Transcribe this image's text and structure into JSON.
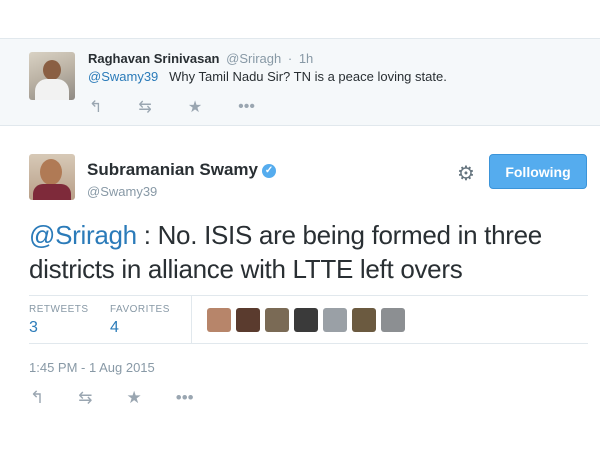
{
  "reply_tweet": {
    "author_name": "Raghavan Srinivasan",
    "author_handle": "@Sriragh",
    "separator": "·",
    "time_ago": "1h",
    "mention": "@Swamy39",
    "text": "Why Tamil Nadu Sir?  TN is a peace loving state.",
    "actions": [
      {
        "name": "reply",
        "glyph": "↰"
      },
      {
        "name": "retweet",
        "glyph": "⇆"
      },
      {
        "name": "favorite",
        "glyph": "★"
      },
      {
        "name": "more",
        "glyph": "•••"
      }
    ]
  },
  "main_tweet": {
    "author_name": "Subramanian Swamy",
    "verified_glyph": "✓",
    "author_handle": "@Swamy39",
    "follow_label": "Following",
    "gear_glyph": "⚙",
    "mention": "@Sriragh",
    "text": " : No. ISIS are being formed in three districts in alliance with LTTE left overs",
    "stats": {
      "retweets_label": "RETWEETS",
      "retweets_value": "3",
      "favorites_label": "FAVORITES",
      "favorites_value": "4"
    },
    "favoriter_avatar_colors": [
      "#b7856a",
      "#5a3b2e",
      "#7a6a55",
      "#3a3a3a",
      "#9aa0a6",
      "#6b5a40",
      "#8c8f92"
    ],
    "timestamp": "1:45 PM - 1 Aug 2015",
    "actions": [
      {
        "name": "reply",
        "glyph": "↰"
      },
      {
        "name": "retweet",
        "glyph": "⇆"
      },
      {
        "name": "favorite",
        "glyph": "★"
      },
      {
        "name": "more",
        "glyph": "•••"
      }
    ]
  },
  "colors": {
    "accent": "#55acee",
    "link": "#2b7bb9",
    "muted": "#8899a6",
    "text": "#292f33"
  }
}
